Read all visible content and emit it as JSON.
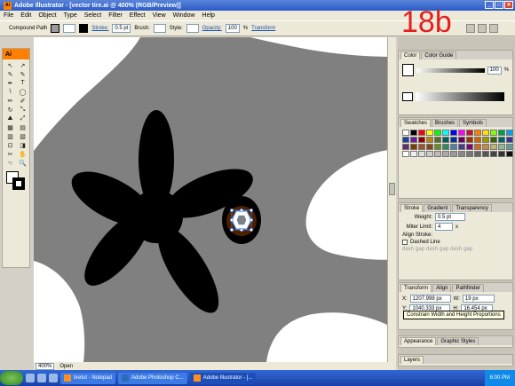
{
  "window": {
    "title": "Adobe Illustrator - [vector tire.ai @ 400% (RGB/Preview)]",
    "min": "_",
    "max": "□",
    "close": "✕"
  },
  "menu": [
    "File",
    "Edit",
    "Object",
    "Type",
    "Select",
    "Filter",
    "Effect",
    "View",
    "Window",
    "Help"
  ],
  "control": {
    "selection": "Compound Path",
    "stroke_label": "Stroke:",
    "stroke_value": "0.5 pt",
    "brush_label": "Brush:",
    "style_label": "Style:",
    "opacity_label": "Opacity:",
    "opacity_value": "100",
    "opacity_unit": "%",
    "transform_label": "Transform",
    "fill_color": "#999999",
    "stroke_color": "#000000"
  },
  "step_label": "18b",
  "toolbox": {
    "logo": "Ai",
    "tools": [
      "↖",
      "↗",
      "✎",
      "✎",
      "✒",
      "T",
      "\\",
      "◯",
      "✏",
      "✐",
      "↻",
      "⤡",
      "⛰",
      "⤢",
      "▦",
      "▤",
      "▥",
      "▧",
      "⊡",
      "◨",
      "✂",
      "✋",
      "☜",
      "🔍"
    ]
  },
  "status": {
    "zoom": "400%",
    "doc_status": "Open"
  },
  "color_panel": {
    "tabs": [
      "Color",
      "Color Guide"
    ],
    "value": "100",
    "unit": "%"
  },
  "swatches_panel": {
    "tabs": [
      "Swatches",
      "Brushes",
      "Symbols"
    ],
    "colors": [
      "#ffffff",
      "#000000",
      "#ff0000",
      "#ffff00",
      "#00ff00",
      "#00ffff",
      "#0000ff",
      "#ff00ff",
      "#c8102e",
      "#ff7f00",
      "#ffde00",
      "#7fff00",
      "#009e4f",
      "#00a2e8",
      "#1f3f9f",
      "#6a1b9a",
      "#8b0000",
      "#b8860b",
      "#556b2f",
      "#006060",
      "#003399",
      "#660066",
      "#993300",
      "#cc6600",
      "#999900",
      "#336600",
      "#006666",
      "#333399",
      "#5b2c6f",
      "#7b3f00",
      "#a0522d",
      "#8b4513",
      "#6b8e23",
      "#2e8b57",
      "#4682b4",
      "#483d8b",
      "#800080",
      "#d2691e",
      "#cd853f",
      "#bdb76b",
      "#8fbc8f",
      "#5f9ea0",
      "#ffffff",
      "#eeeeee",
      "#dddddd",
      "#cccccc",
      "#bbbbbb",
      "#aaaaaa",
      "#999999",
      "#888888",
      "#777777",
      "#666666",
      "#555555",
      "#444444",
      "#333333",
      "#111111"
    ]
  },
  "stroke_panel": {
    "tabs": [
      "Stroke",
      "Gradient",
      "Transparency"
    ],
    "weight_label": "Weight:",
    "weight_value": "0.5 pt",
    "miter_label": "Miter Limit:",
    "miter_value": "4",
    "miter_unit": "x",
    "align_label": "Align Stroke:",
    "dashed_label": "Dashed Line",
    "dash_labels": [
      "dash",
      "gap",
      "dash",
      "gap",
      "dash",
      "gap"
    ]
  },
  "transform_panel": {
    "tabs": [
      "Transform",
      "Align",
      "Pathfinder"
    ],
    "x_label": "X:",
    "x_value": "1207.998 px",
    "y_label": "Y:",
    "y_value": "1040.333 px",
    "w_label": "W:",
    "w_value": "19 px",
    "h_label": "H:",
    "h_value": "16.454 px"
  },
  "tooltip": "Constrain Width and Height Proportions",
  "appearance_panel": {
    "tabs": [
      "Appearance",
      "Graphic Styles"
    ]
  },
  "layers_panel": {
    "tabs": [
      "Layers"
    ]
  },
  "taskbar": {
    "tasks": [
      {
        "label": "tiretut - Notepad",
        "active": false
      },
      {
        "label": "Adobe Photoshop C...",
        "active": false
      },
      {
        "label": "Adobe Illustrator - [...",
        "active": true
      }
    ],
    "clock": "6:00 PM"
  }
}
